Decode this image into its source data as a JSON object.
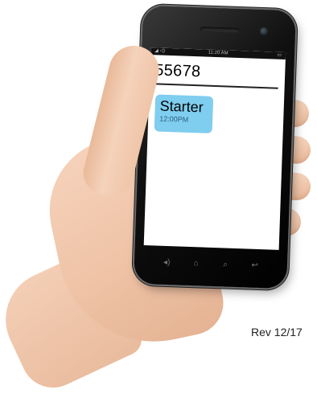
{
  "phone": {
    "status_bar": {
      "time": "11:20 AM",
      "left_icons": "◢ ◁)",
      "right_icon": "▭"
    },
    "conversation": {
      "contact": "55678"
    },
    "messages": [
      {
        "text": "Starter",
        "time": "12:00PM",
        "bubble_color": "#7fcdef"
      }
    ],
    "softkeys": [
      {
        "icon": "speaker-icon",
        "glyph": "◂)"
      },
      {
        "icon": "home-icon",
        "glyph": "⌂"
      },
      {
        "icon": "search-icon",
        "glyph": "⌕"
      },
      {
        "icon": "back-icon",
        "glyph": "↩"
      }
    ]
  },
  "footer": {
    "revision": "Rev 12/17"
  }
}
